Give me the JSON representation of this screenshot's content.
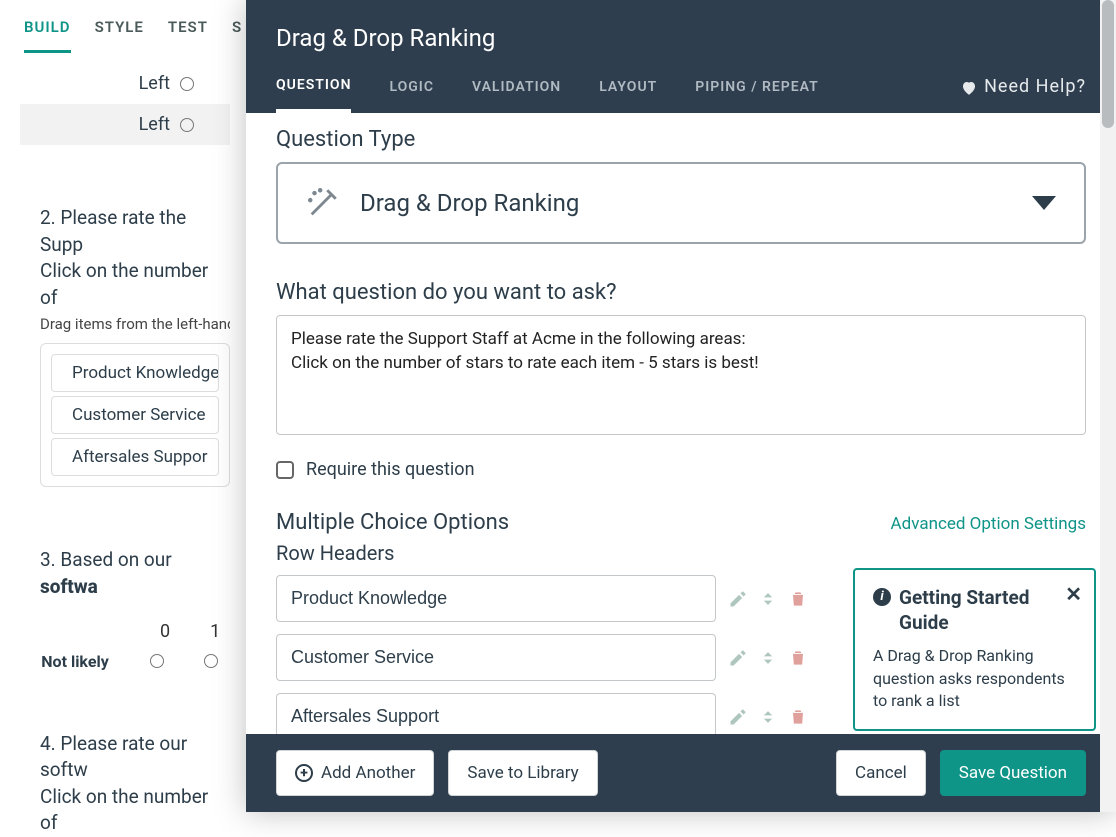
{
  "top_tabs": {
    "build": "BUILD",
    "style": "STYLE",
    "test": "TEST",
    "extra": "S"
  },
  "bg": {
    "left1": "Left",
    "left2": "Left",
    "q2_line1": "2. Please rate the Supp",
    "q2_line2": "Click on the number of",
    "q2_hint": "Drag items from the left-hand",
    "pill1": "Product Knowledge",
    "pill2": "Customer Service",
    "pill3": "Aftersales Suppor",
    "q3_prefix": "3. Based on our ",
    "q3_bold": "softwa",
    "scale_0": "0",
    "scale_1": "1",
    "not_likely": "Not likely",
    "q4_line1": "4. Please rate our softw",
    "q4_line2": "Click on the number of"
  },
  "modal": {
    "title": "Drag & Drop Ranking",
    "tabs": {
      "question": "QUESTION",
      "logic": "LOGIC",
      "validation": "VALIDATION",
      "layout": "LAYOUT",
      "piping": "PIPING / REPEAT"
    },
    "help": "Need Help?",
    "qtype_label": "Question Type",
    "qtype_value": "Drag & Drop Ranking",
    "ask_label": "What question do you want to ask?",
    "ask_value": "Please rate the Support Staff at Acme in the following areas:\nClick on the number of stars to rate each item - 5 stars is best!",
    "require_label": "Require this question",
    "mco_label": "Multiple Choice Options",
    "adv_link": "Advanced Option Settings",
    "row_header_label": "Row Headers",
    "rows": [
      "Product Knowledge",
      "Customer Service",
      "Aftersales Support"
    ],
    "gs_title": "Getting Started Guide",
    "gs_body": "A Drag & Drop Ranking question asks respondents to rank a list",
    "add_another": "Add Another",
    "save_library": "Save to Library",
    "cancel": "Cancel",
    "save": "Save Question"
  }
}
